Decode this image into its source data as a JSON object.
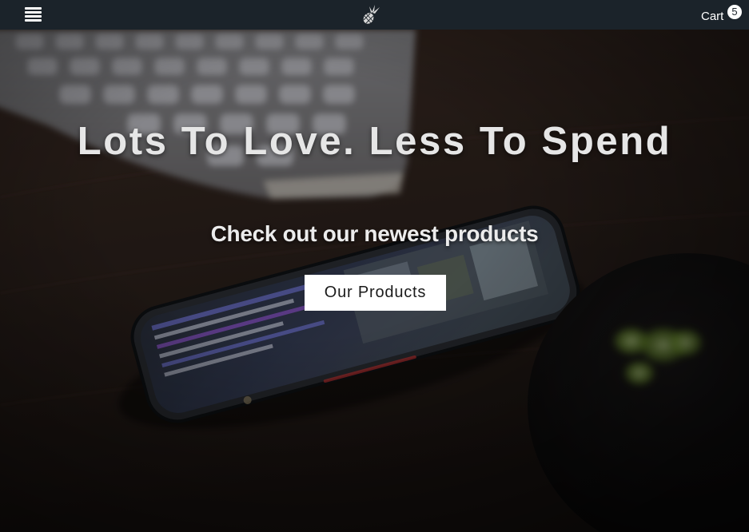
{
  "navbar": {
    "menu_icon": "hamburger-menu-icon",
    "logo_icon": "pineapple-logo-icon",
    "cart_label": "Cart",
    "cart_count": "5"
  },
  "hero": {
    "title": "Lots To Love. Less To Spend",
    "subtitle": "Check out our newest products",
    "cta_label": "Our Products",
    "background_image": "dark photo of a smartphone on a wooden desk next to a keyboard and a speaker"
  },
  "colors": {
    "navbar_bg": "#1b232a",
    "hero_text": "#e6e6e6",
    "button_bg": "#ffffff",
    "button_text": "#1b1b1b",
    "speaker_glow": "#9acb4a"
  }
}
